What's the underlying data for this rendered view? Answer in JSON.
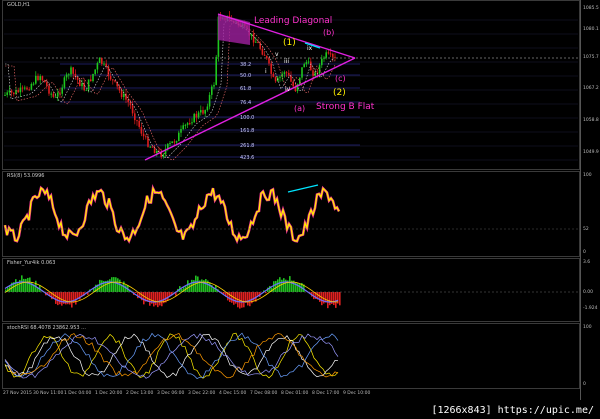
{
  "panels": {
    "main_label": "GOLD,H1",
    "rsi_label": "RSI(8) 53.0996",
    "fisher_label": "Fisher_Yur4ik 0.063",
    "stoch_label": "stochRSI 68.4078 23862.953 ..."
  },
  "annotations": {
    "leading_diagonal": "Leading Diagonal",
    "b_small": "(b)",
    "wave_1": "(1)",
    "wave_c": "(c)",
    "wave_a": "(a)",
    "wave_2": "(2)",
    "strong_b_flat": "Strong B Flat",
    "sub_ix": "ix",
    "sub_v": "v",
    "sub_iii": "iii",
    "sub_iv": "iv",
    "sub_i": "i"
  },
  "price_scale": [
    "1085.5",
    "1080.1",
    "1075.7",
    "1067.2",
    "1058.8",
    "1049.9"
  ],
  "rsi_scale": [
    "100",
    "52",
    "0"
  ],
  "fisher_scale": [
    "3.6",
    "0.00",
    "-1.924"
  ],
  "stoch_scale": [
    "100",
    "0"
  ],
  "x_labels": [
    "27 Nov 2015",
    "30 Nov 11:00",
    "1 Dec 04:00",
    "1 Dec 20:00",
    "2 Dec 13:00",
    "3 Dec 06:00",
    "3 Dec 22:00",
    "4 Dec 15:00",
    "7 Dec 08:00",
    "8 Dec 01:00",
    "8 Dec 17:00",
    "9 Dec 10:00"
  ],
  "fib_labels": [
    "38.2",
    "50.0",
    "61.8",
    "76.4",
    "100.0",
    "161.8",
    "261.8",
    "423.6"
  ],
  "watermark": "[1266x843] https://upic.me/",
  "colors": {
    "bull_candle": "#1ec81e",
    "bear_candle": "#e01e1e",
    "triangle": "#e020e0",
    "diagonal_fill": "#a020a0",
    "annotation_pink": "#ff33cc",
    "annotation_yellow": "#ffee00",
    "cyan": "#00e5ff",
    "rsi": "#ffee00"
  }
}
